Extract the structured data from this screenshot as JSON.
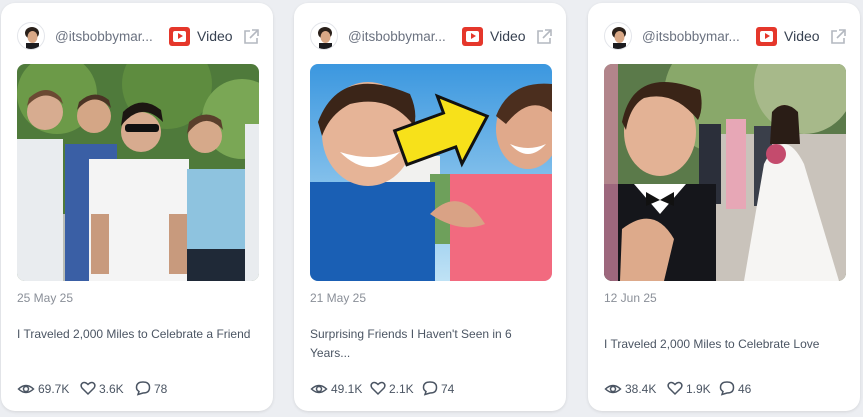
{
  "cards": [
    {
      "handle": "@itsbobbymar...",
      "platform_label": "Video",
      "date": "25 May 25",
      "title": "I Traveled 2,000 Miles to Celebrate a Friend",
      "views": "69.7K",
      "likes": "3.6K",
      "comments": "78"
    },
    {
      "handle": "@itsbobbymar...",
      "platform_label": "Video",
      "date": "21 May 25",
      "title": "Surprising Friends I Haven't Seen in 6 Years...",
      "views": "49.1K",
      "likes": "2.1K",
      "comments": "74"
    },
    {
      "handle": "@itsbobbymar...",
      "platform_label": "Video",
      "date": "12 Jun 25",
      "title": "I Traveled 2,000 Miles to Celebrate Love",
      "views": "38.4K",
      "likes": "1.9K",
      "comments": "46"
    }
  ],
  "icons": {
    "platform": "youtube-icon",
    "external": "external-link-icon",
    "views": "eye-icon",
    "likes": "heart-icon",
    "comments": "comment-icon"
  },
  "colors": {
    "youtube_red": "#e5372b",
    "background": "#eceef2",
    "card": "#ffffff",
    "muted_text": "#8a8f98",
    "arrow_yellow": "#f7e11a"
  }
}
